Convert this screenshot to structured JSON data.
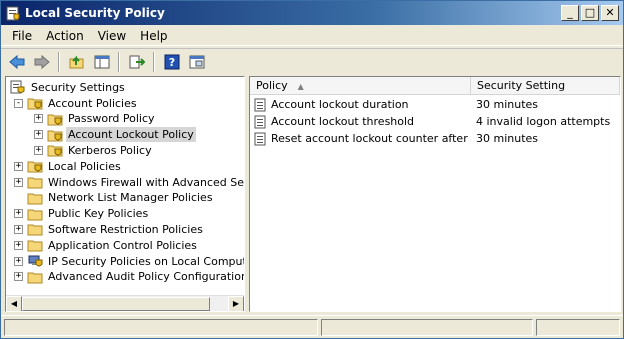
{
  "window": {
    "title": "Local Security Policy",
    "controls": {
      "minimize": "_",
      "maximize": "□",
      "close": "✕"
    }
  },
  "menu": [
    "File",
    "Action",
    "View",
    "Help"
  ],
  "toolbar": {
    "buttons": [
      "back-icon",
      "forward-icon",
      "up-folder-icon",
      "show-hide-tree-icon",
      "export-list-icon",
      "help-icon",
      "properties-icon"
    ]
  },
  "tree": {
    "root": "Security Settings",
    "items": [
      {
        "label": "Account Policies",
        "expander": "-",
        "level": 1,
        "icon": "folder-shield-icon"
      },
      {
        "label": "Password Policy",
        "expander": "+",
        "level": 2,
        "icon": "folder-shield-icon"
      },
      {
        "label": "Account Lockout Policy",
        "expander": "+",
        "level": 2,
        "icon": "folder-shield-icon",
        "selected": true
      },
      {
        "label": "Kerberos Policy",
        "expander": "+",
        "level": 2,
        "icon": "folder-shield-icon"
      },
      {
        "label": "Local Policies",
        "expander": "+",
        "level": 1,
        "icon": "folder-shield-icon"
      },
      {
        "label": "Windows Firewall with Advanced Security",
        "expander": "+",
        "level": 1,
        "icon": "folder-icon"
      },
      {
        "label": "Network List Manager Policies",
        "expander": "",
        "level": 1,
        "icon": "folder-icon"
      },
      {
        "label": "Public Key Policies",
        "expander": "+",
        "level": 1,
        "icon": "folder-icon"
      },
      {
        "label": "Software Restriction Policies",
        "expander": "+",
        "level": 1,
        "icon": "folder-icon"
      },
      {
        "label": "Application Control Policies",
        "expander": "+",
        "level": 1,
        "icon": "folder-icon"
      },
      {
        "label": "IP Security Policies on Local Computer",
        "expander": "+",
        "level": 1,
        "icon": "ip-security-icon"
      },
      {
        "label": "Advanced Audit Policy Configuration",
        "expander": "+",
        "level": 1,
        "icon": "folder-icon"
      }
    ]
  },
  "list": {
    "columns": {
      "policy": "Policy",
      "setting": "Security Setting"
    },
    "rows": [
      {
        "policy": "Account lockout duration",
        "setting": "30 minutes"
      },
      {
        "policy": "Account lockout threshold",
        "setting": "4 invalid logon attempts"
      },
      {
        "policy": "Reset account lockout counter after",
        "setting": "30 minutes"
      }
    ]
  },
  "scrollbar": {
    "left_arrow": "◀",
    "right_arrow": "▶"
  },
  "colors": {
    "titlebar": "#0a246a",
    "selection": "#d6d6d6",
    "folder": "#f5d77a"
  }
}
